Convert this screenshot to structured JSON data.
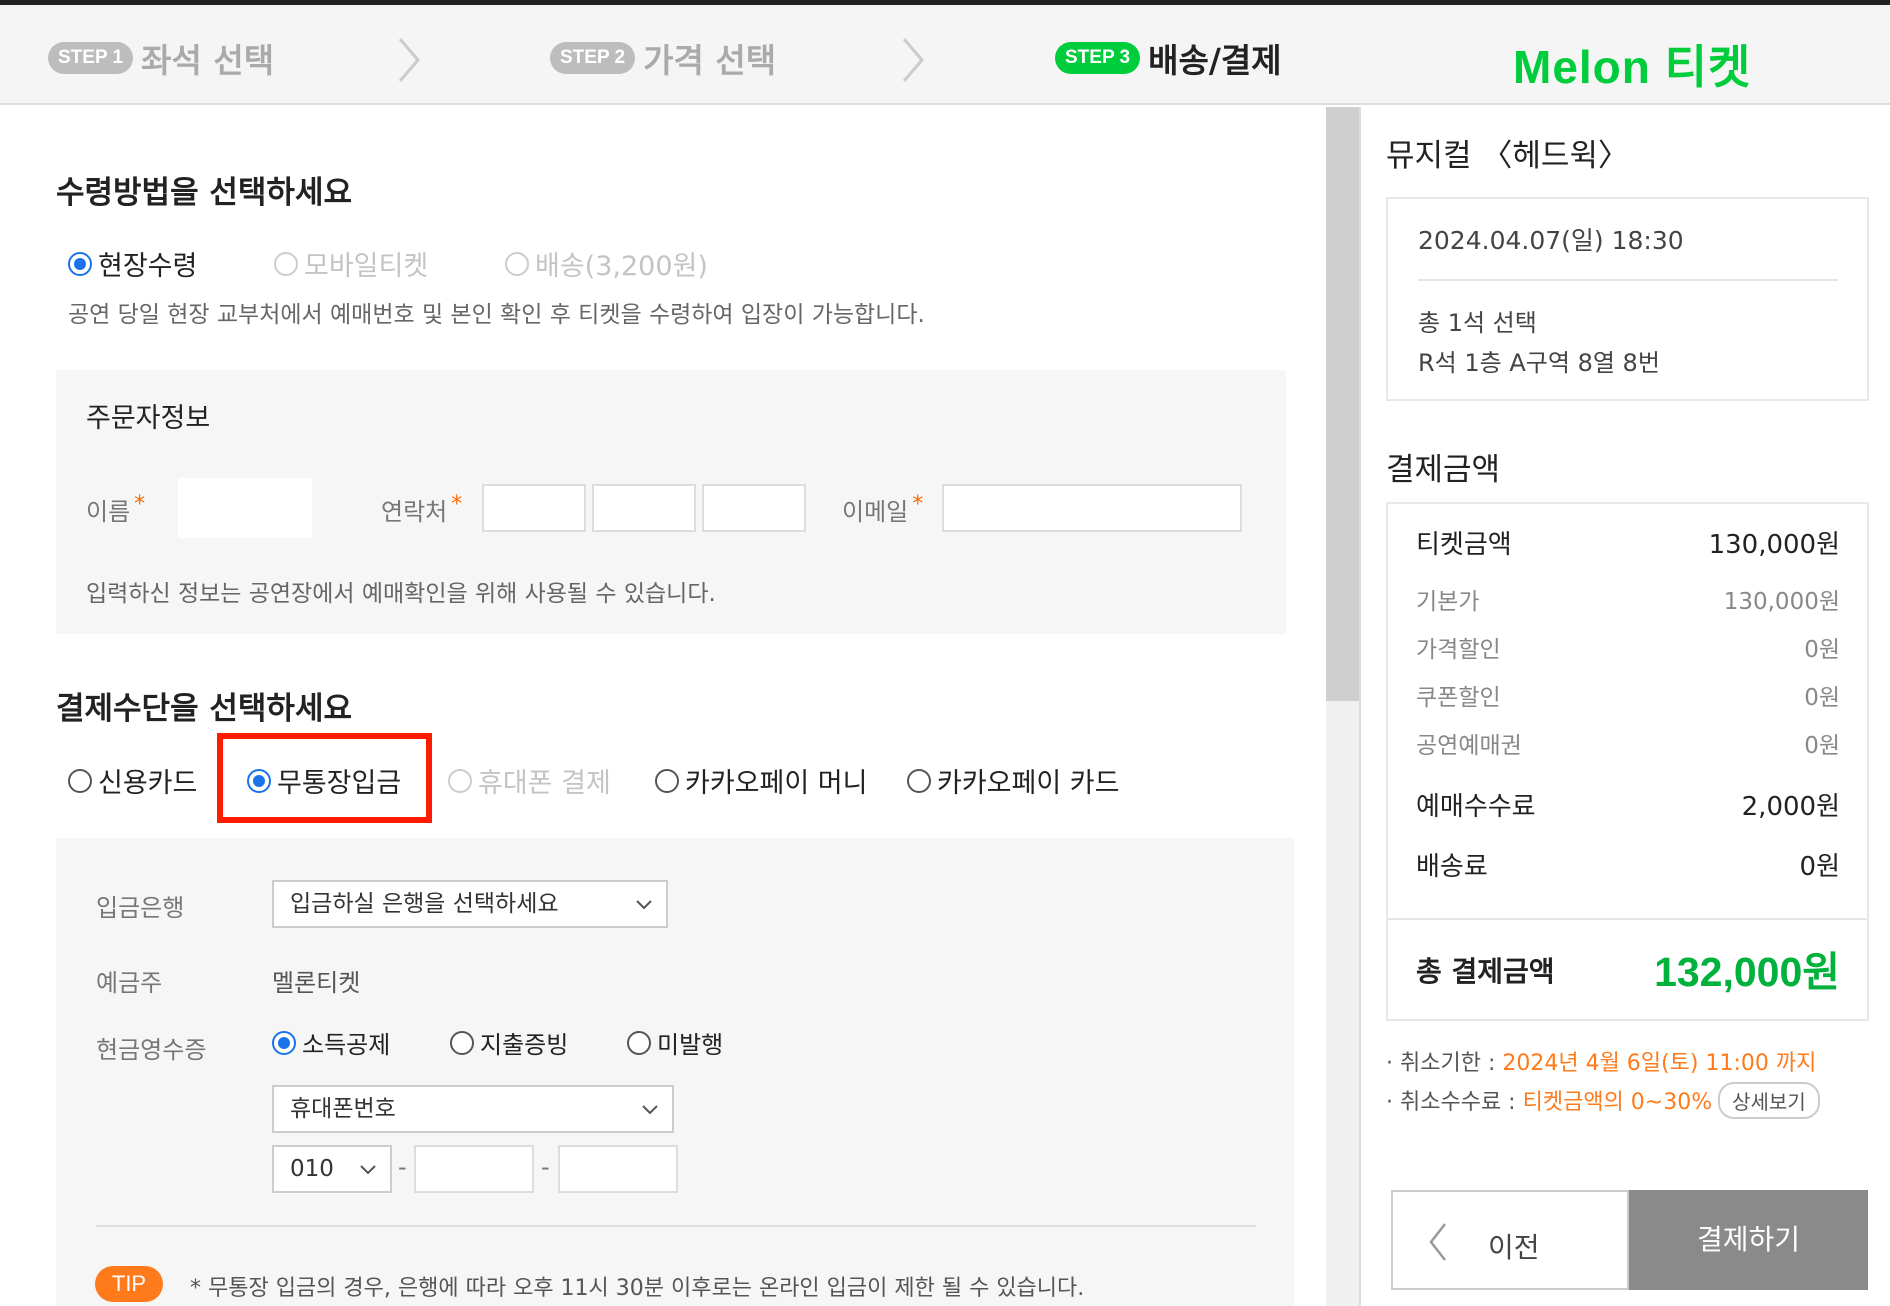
{
  "steps": [
    {
      "badge": "STEP 1",
      "label": "좌석 선택"
    },
    {
      "badge": "STEP 2",
      "label": "가격 선택"
    },
    {
      "badge": "STEP 3",
      "label": "배송/결제"
    }
  ],
  "brand": "Melon 티켓",
  "receipt": {
    "title": "수령방법을 선택하세요",
    "options": [
      "현장수령",
      "모바일티켓",
      "배송(3,200원)"
    ],
    "selected": "현장수령",
    "description": "공연 당일 현장 교부처에서 예매번호 및 본인 확인 후 티켓을 수령하여 입장이 가능합니다."
  },
  "orderer": {
    "title": "주문자정보",
    "name_label": "이름",
    "contact_label": "연락처",
    "email_label": "이메일",
    "required_mark": "*",
    "notice": "입력하신 정보는 공연장에서 예매확인을 위해 사용될 수 있습니다."
  },
  "payment": {
    "title": "결제수단을 선택하세요",
    "methods": [
      "신용카드",
      "무통장입금",
      "휴대폰 결제",
      "카카오페이 머니",
      "카카오페이 카드"
    ],
    "selected": "무통장입금",
    "bank_label": "입금은행",
    "bank_placeholder": "입금하실 은행을 선택하세요",
    "holder_label": "예금주",
    "holder_value": "멜론티켓",
    "receipt_label": "현금영수증",
    "receipt_options": [
      "소득공제",
      "지출증빙",
      "미발행"
    ],
    "receipt_selected": "소득공제",
    "id_type": "휴대폰번호",
    "phone_prefix": "010",
    "dash": "-",
    "tip_badge": "TIP",
    "tip_text": "* 무통장 입금의 경우, 은행에 따라 오후 11시 30분 이후로는 온라인 입금이 제한 될 수 있습니다."
  },
  "summary": {
    "show_title": "뮤지컬 〈헤드윅〉",
    "datetime": "2024.04.07(일) 18:30",
    "seat_count": "총 1석 선택",
    "seat_info": "R석 1층 A구역 8열 8번",
    "price_title": "결제금액",
    "rows": [
      {
        "label": "티켓금액",
        "value": "130,000원"
      },
      {
        "label": "기본가",
        "value": "130,000원"
      },
      {
        "label": "가격할인",
        "value": "0원"
      },
      {
        "label": "쿠폰할인",
        "value": "0원"
      },
      {
        "label": "공연예매권",
        "value": "0원"
      },
      {
        "label": "예매수수료",
        "value": "2,000원"
      },
      {
        "label": "배송료",
        "value": "0원"
      }
    ],
    "total_label": "총 결제금액",
    "total_value": "132,000원",
    "cancel_deadline_label": "· 취소기한 : ",
    "cancel_deadline_value": "2024년 4월 6일(토) 11:00 까지",
    "cancel_fee_label": "· 취소수수료 : ",
    "cancel_fee_value": "티켓금액의 0~30%",
    "detail_button": "상세보기",
    "prev_button": "이전",
    "pay_button": "결제하기"
  },
  "colors": {
    "brand_green": "#00cd3c",
    "highlight_red": "#ff1a00",
    "accent_orange": "#ff7a1a",
    "radio_blue": "#1a73e8"
  }
}
